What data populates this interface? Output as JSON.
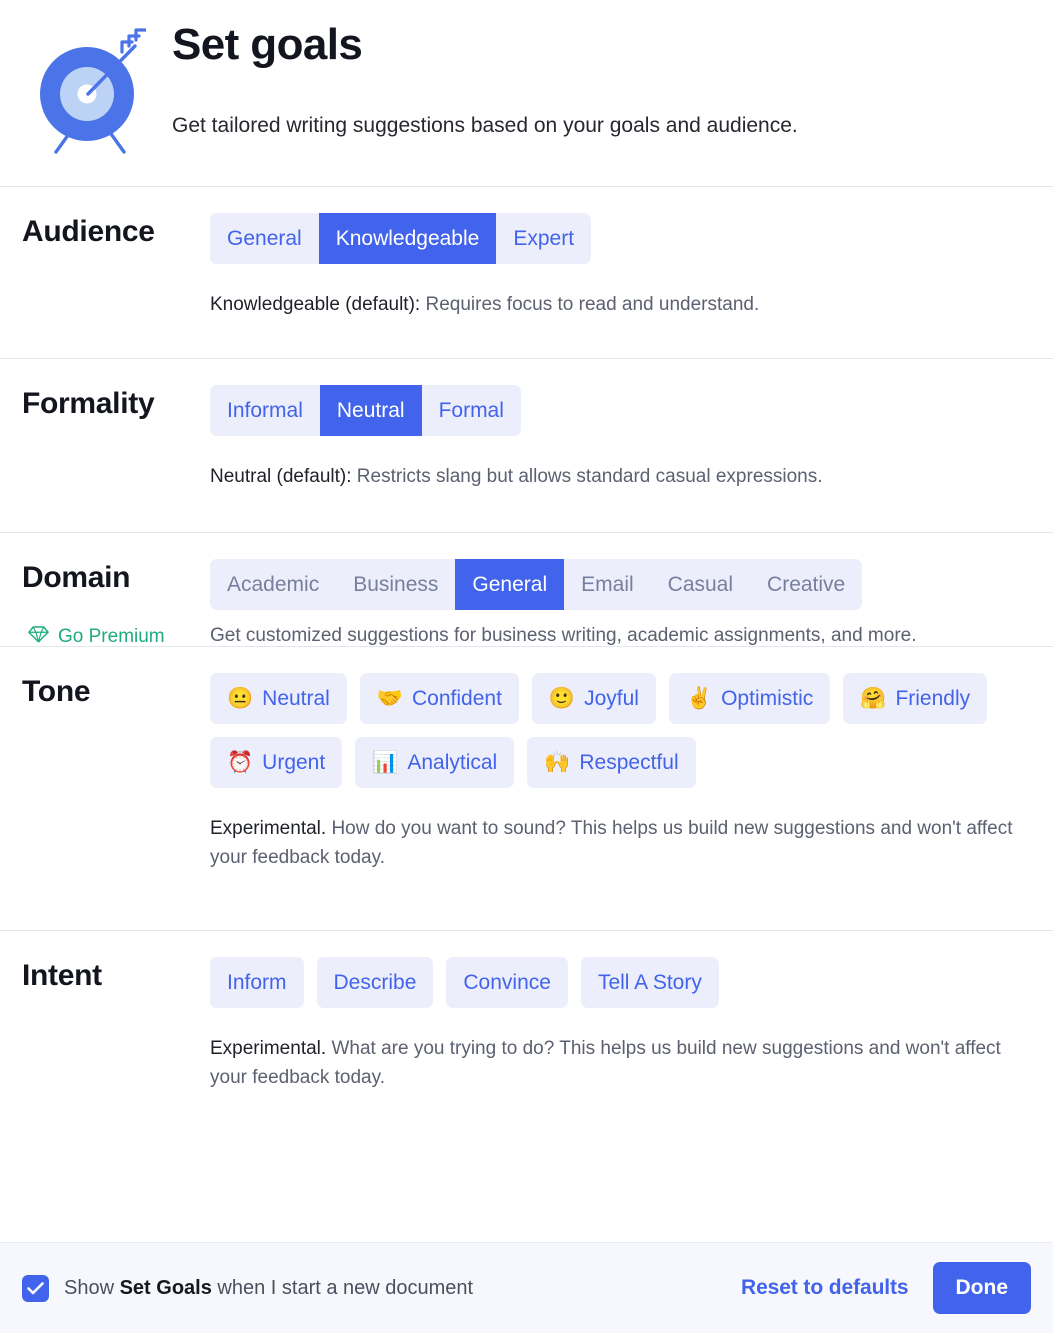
{
  "header": {
    "icon": "target-with-arrow-icon",
    "title": "Set goals",
    "subtitle": "Get tailored writing suggestions based on your goals and audience."
  },
  "sections": {
    "audience": {
      "label": "Audience",
      "options": [
        {
          "label": "General",
          "selected": false
        },
        {
          "label": "Knowledgeable",
          "selected": true
        },
        {
          "label": "Expert",
          "selected": false
        }
      ],
      "helper_strong": "Knowledgeable (default):",
      "helper_rest": " Requires focus to read and understand."
    },
    "formality": {
      "label": "Formality",
      "options": [
        {
          "label": "Informal",
          "selected": false
        },
        {
          "label": "Neutral",
          "selected": true
        },
        {
          "label": "Formal",
          "selected": false
        }
      ],
      "helper_strong": "Neutral (default):",
      "helper_rest": " Restricts slang but allows standard casual expressions."
    },
    "domain": {
      "label": "Domain",
      "options": [
        {
          "label": "Academic",
          "selected": false,
          "locked": true
        },
        {
          "label": "Business",
          "selected": false,
          "locked": true
        },
        {
          "label": "General",
          "selected": true,
          "locked": false
        },
        {
          "label": "Email",
          "selected": false,
          "locked": true
        },
        {
          "label": "Casual",
          "selected": false,
          "locked": true
        },
        {
          "label": "Creative",
          "selected": false,
          "locked": true
        }
      ],
      "premium_icon": "diamond-icon",
      "premium_label": "Go Premium",
      "description": "Get customized suggestions for business writing, academic assignments, and more."
    },
    "tone": {
      "label": "Tone",
      "options": [
        {
          "emoji": "😐",
          "icon_name": "neutral-face-emoji",
          "label": "Neutral"
        },
        {
          "emoji": "🤝",
          "icon_name": "handshake-emoji",
          "label": "Confident"
        },
        {
          "emoji": "🙂",
          "icon_name": "slightly-smiling-face-emoji",
          "label": "Joyful"
        },
        {
          "emoji": "✌️",
          "icon_name": "victory-hand-emoji",
          "label": "Optimistic"
        },
        {
          "emoji": "🤗",
          "icon_name": "hugging-face-emoji",
          "label": "Friendly"
        },
        {
          "emoji": "⏰",
          "icon_name": "alarm-clock-emoji",
          "label": "Urgent"
        },
        {
          "emoji": "📊",
          "icon_name": "bar-chart-emoji",
          "label": "Analytical"
        },
        {
          "emoji": "🙌",
          "icon_name": "raising-hands-emoji",
          "label": "Respectful"
        }
      ],
      "helper_strong": "Experimental.",
      "helper_rest": " How do you want to sound? This helps us build new suggestions and won't affect your feedback today."
    },
    "intent": {
      "label": "Intent",
      "options": [
        {
          "label": "Inform"
        },
        {
          "label": "Describe"
        },
        {
          "label": "Convince"
        },
        {
          "label": "Tell A Story"
        }
      ],
      "helper_strong": "Experimental.",
      "helper_rest": " What are you trying to do? This helps us build new suggestions and won't affect your feedback today."
    }
  },
  "footer": {
    "checkbox_checked": true,
    "label_before": "Show ",
    "label_bold": "Set Goals",
    "label_after": " when I start a new document",
    "reset_label": "Reset to defaults",
    "done_label": "Done"
  },
  "colors": {
    "accent": "#4263eb",
    "chip_bg": "#eceefb",
    "premium_green": "#1fab7f",
    "divider": "#e3e6ef",
    "footer_bg": "#f7f8fd"
  }
}
